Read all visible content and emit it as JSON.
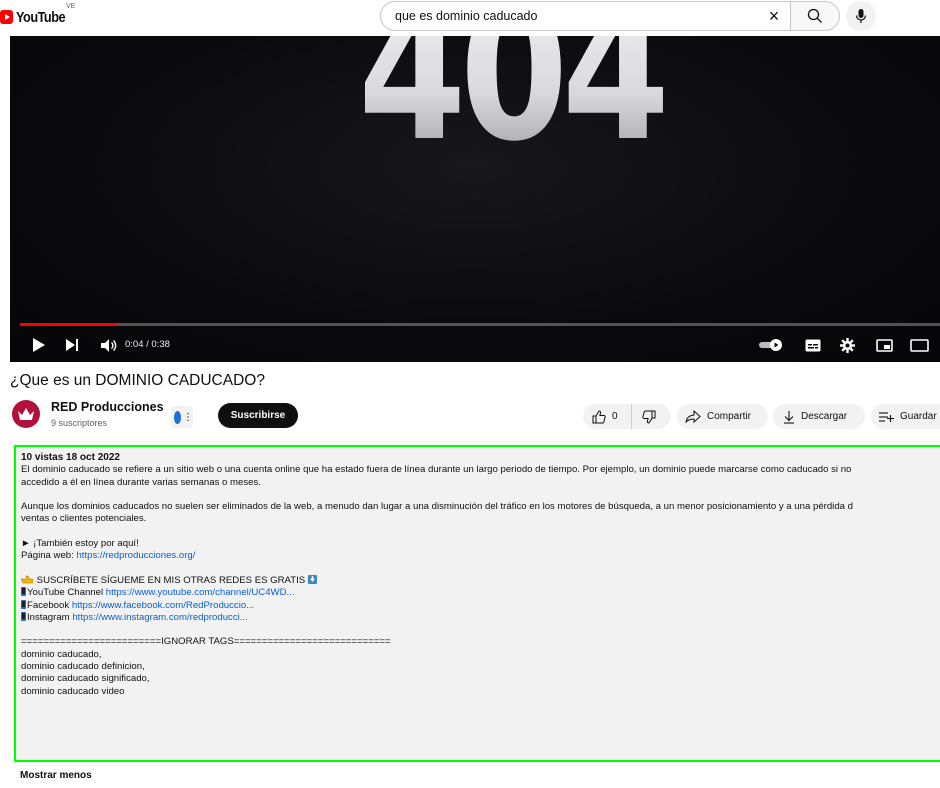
{
  "header": {
    "logo_text": "YouTube",
    "country_code": "VE",
    "search_value": "que es dominio caducado"
  },
  "player": {
    "frame_text": "404",
    "time_display": "0:04 / 0:38",
    "progress_fraction": 0.105,
    "accent_color": "#ff0000"
  },
  "video": {
    "title": "¿Que es un DOMINIO CADUCADO?",
    "channel_name": "RED Producciones",
    "subscribers": "9 suscriptores",
    "subscribe_label": "Suscribirse",
    "like_count": "0",
    "share_label": "Compartir",
    "download_label": "Descargar",
    "save_label": "Guardar"
  },
  "description": {
    "meta": "10 vistas  18 oct 2022",
    "p1_line1": "El dominio caducado se refiere a un sitio web o una cuenta online que ha estado fuera de línea durante un largo periodo de tiempo. Por ejemplo, un dominio puede marcarse como caducado si no",
    "p1_line2": "accedido a él en línea durante varias semanas o meses.",
    "p2_line1": "Aunque los dominios caducados no suelen ser eliminados de la web, a menudo dan lugar a una disminución del tráfico en los motores de búsqueda, a un menor posicionamiento y a una pérdida d",
    "p2_line2": "ventas o clientes potenciales.",
    "also_here": "► ¡También estoy por aquí!",
    "website_label": "Página web: ",
    "website_url": "https://redproducciones.org/",
    "follow_line": " SUSCRÍBETE  SÍGUEME EN MIS OTRAS REDES ES GRATIS ",
    "youtube_label": "YouTube Channel ",
    "youtube_url": "https://www.youtube.com/channel/UC4WD...",
    "facebook_label": "Facebook ",
    "facebook_url": "https://www.facebook.com/RedProduccio...",
    "instagram_label": "Instagram ",
    "instagram_url": "https://www.instagram.com/redproducci...",
    "tags_header": "=========================IGNORAR TAGS============================",
    "tag1": "dominio caducado,",
    "tag2": "dominio caducado definicion,",
    "tag3": "dominio caducado significado,",
    "tag4": "dominio caducado video",
    "show_less": "Mostrar menos"
  }
}
